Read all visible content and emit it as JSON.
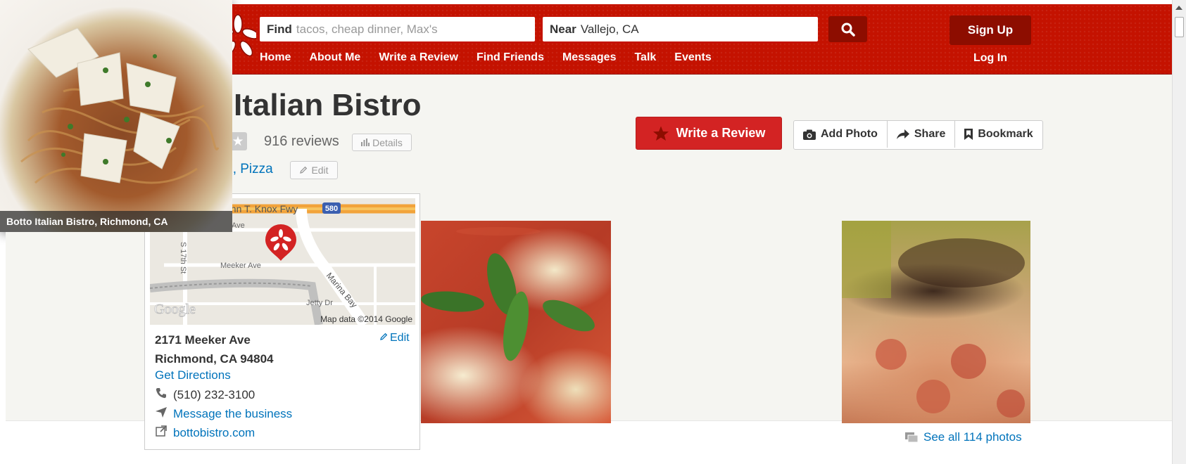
{
  "header": {
    "logo_text": "yelp",
    "search": {
      "find_label": "Find",
      "find_placeholder": "tacos, cheap dinner, Max's",
      "near_label": "Near",
      "near_value": "Vallejo, CA"
    },
    "nav": [
      "Home",
      "About Me",
      "Write a Review",
      "Find Friends",
      "Messages",
      "Talk",
      "Events"
    ],
    "signup_label": "Sign Up",
    "login_label": "Log In"
  },
  "business": {
    "name": "Botto Italian Bistro",
    "rating_stars": 1,
    "rating_max": 5,
    "review_count_text": "916 reviews",
    "details_label": "Details",
    "price": "$$$$",
    "separator": "·",
    "categories": "Italian, Pizza",
    "edit_label": "Edit"
  },
  "actions": {
    "write_review": "Write a Review",
    "add_photo": "Add Photo",
    "share": "Share",
    "bookmark": "Bookmark"
  },
  "map": {
    "labels": {
      "freeway": "John T. Knox Fwy",
      "shield": "580",
      "wright": "Wright Ave",
      "s17th": "S 17th St",
      "meeker": "Meeker Ave",
      "marina": "Marina Bay",
      "jetty": "Jetty Dr",
      "google": "Google",
      "copyright": "Map data ©2014 Google"
    }
  },
  "contact": {
    "address_line1": "2171 Meeker Ave",
    "address_line2": "Richmond, CA 94804",
    "edit_label": "Edit",
    "directions": "Get Directions",
    "phone": "(510) 232-3100",
    "message": "Message the business",
    "website": "bottobistro.com"
  },
  "photos": {
    "caption": "Botto Italian Bistro, Richmond, CA",
    "see_all": "See all 114 photos"
  },
  "colors": {
    "brand_red": "#c41200",
    "dark_red": "#8d0d00",
    "button_red": "#d32323",
    "link_blue": "#0073bb",
    "star_orange": "#c3792b"
  }
}
